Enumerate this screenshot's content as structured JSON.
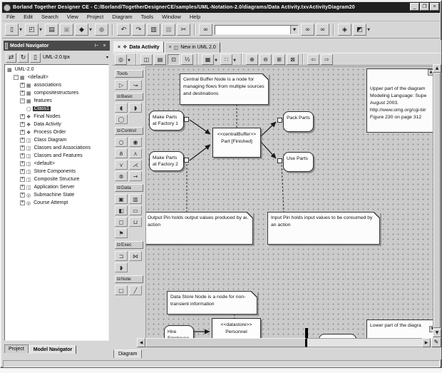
{
  "window": {
    "title": "Borland Together Designer CE - C:/Borland/TogetherDesignerCE/samples/UML-Notation-2.0/diagrams/Data Activity.txvActivityDiagram20",
    "controls": {
      "minimize": "_",
      "restore": "❐",
      "close": "×"
    }
  },
  "menu": {
    "items": [
      "File",
      "Edit",
      "Search",
      "View",
      "Project",
      "Diagram",
      "Tools",
      "Window",
      "Help"
    ]
  },
  "toolbar": {
    "find_value": "",
    "buttons": [
      {
        "name": "new-button",
        "glyph": "▯",
        "dropdown": true
      },
      {
        "name": "open-button",
        "glyph": "◰",
        "dropdown": true
      },
      {
        "name": "save-all-button",
        "glyph": "▤"
      },
      {
        "name": "save-button",
        "glyph": "▣",
        "disabled": true
      },
      {
        "name": "new-package-button",
        "glyph": "◆",
        "dropdown": true
      },
      {
        "name": "new-node-button",
        "glyph": "●",
        "disabled": true
      },
      {
        "sep": true
      },
      {
        "name": "undo-button",
        "glyph": "↶"
      },
      {
        "name": "redo-button",
        "glyph": "↷"
      },
      {
        "name": "copy-button",
        "glyph": "▥"
      },
      {
        "name": "paste-button",
        "glyph": "▦",
        "disabled": true
      },
      {
        "name": "cut-button",
        "glyph": "✂"
      },
      {
        "sep": true
      },
      {
        "name": "find-button",
        "glyph": "∞"
      }
    ],
    "buttons_after_find": [
      {
        "name": "find-next-button",
        "glyph": "∞"
      },
      {
        "name": "find-previous-button",
        "glyph": "∞"
      },
      {
        "sep": true
      },
      {
        "name": "help-book-button",
        "glyph": "◈"
      },
      {
        "name": "options-button",
        "glyph": "◩",
        "dropdown": true
      }
    ]
  },
  "sidebar": {
    "title": "Model Navigator",
    "titlebar_buttons": {
      "dock": "⊢",
      "close": "×"
    },
    "toolbar": {
      "buttons": [
        {
          "name": "sync-button",
          "glyph": "⇄"
        },
        {
          "name": "refresh-button",
          "glyph": "↻"
        },
        {
          "name": "project-file-icon",
          "glyph": "▯"
        }
      ],
      "project_label": "UML-2.0.tpx",
      "dropdown_glyph": "▾"
    },
    "tree": [
      {
        "label": "UML-2.0",
        "depth": 0,
        "icon": "project-icon",
        "glyph": "▩"
      },
      {
        "label": "<default>",
        "depth": 1,
        "exp": "-",
        "icon": "package-icon",
        "glyph": "▦"
      },
      {
        "label": "associations",
        "depth": 2,
        "exp": "+",
        "icon": "package-icon",
        "glyph": "▦"
      },
      {
        "label": "compositestructures",
        "depth": 2,
        "exp": "+",
        "icon": "package-icon",
        "glyph": "▦"
      },
      {
        "label": "features",
        "depth": 2,
        "exp": "-",
        "icon": "package-icon",
        "glyph": "▦"
      },
      {
        "label": "Class1",
        "depth": 3,
        "icon": "class-icon",
        "glyph": "▢",
        "selected": true
      },
      {
        "label": "Final Nodes",
        "depth": 2,
        "exp": "+",
        "icon": "activity-diagram-icon",
        "glyph": "❖"
      },
      {
        "label": "Data Activity",
        "depth": 2,
        "exp": "+",
        "icon": "activity-diagram-icon",
        "glyph": "❖"
      },
      {
        "label": "Process Order",
        "depth": 2,
        "exp": "+",
        "icon": "activity-diagram-icon",
        "glyph": "❖"
      },
      {
        "label": "Class Diagram",
        "depth": 2,
        "exp": "+",
        "icon": "class-diagram-icon",
        "glyph": "◫"
      },
      {
        "label": "Classes and Associations",
        "depth": 2,
        "exp": "+",
        "icon": "class-diagram-icon",
        "glyph": "◫"
      },
      {
        "label": "Classes and Features",
        "depth": 2,
        "exp": "+",
        "icon": "class-diagram-icon",
        "glyph": "◫"
      },
      {
        "label": "<default>",
        "depth": 2,
        "exp": "+",
        "icon": "class-diagram-icon",
        "glyph": "◫"
      },
      {
        "label": "Store Components",
        "depth": 2,
        "exp": "+",
        "icon": "component-diagram-icon",
        "glyph": "◫"
      },
      {
        "label": "Composite Structure",
        "depth": 2,
        "exp": "+",
        "icon": "composite-diagram-icon",
        "glyph": "◫"
      },
      {
        "label": "Application Server",
        "depth": 2,
        "exp": "+",
        "icon": "deployment-diagram-icon",
        "glyph": "◫"
      },
      {
        "label": "Submachine State",
        "depth": 2,
        "exp": "+",
        "icon": "state-diagram-icon",
        "glyph": "◎"
      },
      {
        "label": "Course Attempt",
        "depth": 2,
        "exp": "+",
        "icon": "state-diagram-icon",
        "glyph": "◎"
      }
    ],
    "tabs": [
      {
        "label": "Project",
        "active": false
      },
      {
        "label": "Model Navigator",
        "active": true
      }
    ]
  },
  "main": {
    "doc_tabs": [
      {
        "label": "Data Activity",
        "active": true,
        "icon": "activity-diagram-icon",
        "icon_glyph": "❖",
        "close": "×"
      },
      {
        "label": "New in UML 2.0",
        "active": false,
        "icon": "class-diagram-icon",
        "icon_glyph": "◫",
        "close": "×"
      }
    ],
    "diagram_toolbar": [
      {
        "name": "pan-mode-button",
        "glyph": "◎",
        "dropdown": true
      },
      {
        "sep": true
      },
      {
        "name": "export-image-button",
        "glyph": "◫"
      },
      {
        "name": "print-diagram-button",
        "glyph": "▤"
      },
      {
        "name": "actual-size-button",
        "glyph": "⊡",
        "pressed": true
      },
      {
        "name": "zoom-ratio-button",
        "glyph": "½"
      },
      {
        "sep": true
      },
      {
        "name": "layout-button",
        "glyph": "▦",
        "dropdown": true
      },
      {
        "name": "align-button",
        "glyph": "∷",
        "dropdown": true
      },
      {
        "sep": true
      },
      {
        "name": "zoom-in-button",
        "glyph": "⊕"
      },
      {
        "name": "zoom-out-button",
        "glyph": "⊖"
      },
      {
        "name": "zoom-area-button",
        "glyph": "⊞"
      },
      {
        "name": "fit-to-window-button",
        "glyph": "⊠"
      },
      {
        "sep": true
      },
      {
        "name": "back-button",
        "glyph": "⇦"
      },
      {
        "name": "forward-button",
        "glyph": "⇨"
      }
    ],
    "palette": {
      "sections": [
        {
          "label": "Tools",
          "toggle": "",
          "tools": [
            {
              "name": "pointer-tool",
              "glyph": "▷"
            },
            {
              "name": "shortcut-tool",
              "glyph": "↝"
            }
          ]
        },
        {
          "label": "Basic",
          "toggle": "⊟",
          "tools": [
            {
              "name": "activity-tool",
              "glyph": "◖"
            },
            {
              "name": "structured-activity-tool",
              "glyph": "◗"
            },
            {
              "name": "action-tool",
              "glyph": "◯"
            }
          ]
        },
        {
          "label": "Control",
          "toggle": "⊟",
          "tools": [
            {
              "name": "initial-node-tool",
              "glyph": "○"
            },
            {
              "name": "final-node-tool",
              "glyph": "◉"
            },
            {
              "name": "fork-tool",
              "glyph": "⋔"
            },
            {
              "name": "join-tool",
              "glyph": "⋏"
            },
            {
              "name": "decision-tool",
              "glyph": "⋎"
            },
            {
              "name": "merge-tool",
              "glyph": "⋌"
            },
            {
              "name": "flow-final-tool",
              "glyph": "⊗"
            },
            {
              "name": "control-flow-tool",
              "glyph": "→"
            }
          ]
        },
        {
          "label": "Data",
          "toggle": "⊟",
          "tools": [
            {
              "name": "input-pin-tool",
              "glyph": "▣"
            },
            {
              "name": "output-pin-tool",
              "glyph": "▥"
            },
            {
              "name": "central-buffer-tool",
              "glyph": "◧"
            },
            {
              "name": "datastore-tool",
              "glyph": "▭"
            },
            {
              "name": "object-node-tool",
              "glyph": "◻"
            },
            {
              "name": "expansion-region-tool",
              "glyph": "⊔"
            },
            {
              "name": "signal-tool",
              "glyph": "⚑"
            }
          ]
        },
        {
          "label": "Exec",
          "toggle": "⊟",
          "tools": [
            {
              "name": "accept-event-tool",
              "glyph": "⊐"
            },
            {
              "name": "send-signal-tool",
              "glyph": "⋈"
            },
            {
              "name": "time-event-tool",
              "glyph": "◗"
            }
          ]
        },
        {
          "label": "Note",
          "toggle": "⊟",
          "tools": [
            {
              "name": "note-tool",
              "glyph": "▢"
            },
            {
              "name": "note-link-tool",
              "glyph": "╱"
            }
          ]
        }
      ]
    },
    "bottom_tab": "Diagram"
  },
  "canvas": {
    "notes": {
      "central_buffer": "Central Buffer Node is a node for managing flows from multiple sources and destinations",
      "output_pin": "Output Pin holds output values produced by an action",
      "input_pin": "Input Pin holds input values to be consumed by an action",
      "data_store": "Data Store Node is a node for non-transient information",
      "upper_part": "Upper part of the diagram\nModeling Language: Supe\nAugust 2003.\nhttp://www.omg.org/cgi-bir\nFigure 230 on page 312",
      "lower_part": "Lower part of the diagra"
    },
    "nodes": {
      "make_parts_1": "Make Parts at Factory 1",
      "make_parts_2": "Make Parts at Factory 2",
      "central_buffer": {
        "stereotype": "<<centralBuffer>>",
        "name": "Part [Finished]"
      },
      "pack_parts": "Pack Parts",
      "use_parts": "Use Parts",
      "hire_employee": "Hire Employee",
      "personnel": {
        "stereotype": "<<datastore>>",
        "name": "Personnel"
      }
    }
  },
  "statusbar": {
    "text": ""
  }
}
